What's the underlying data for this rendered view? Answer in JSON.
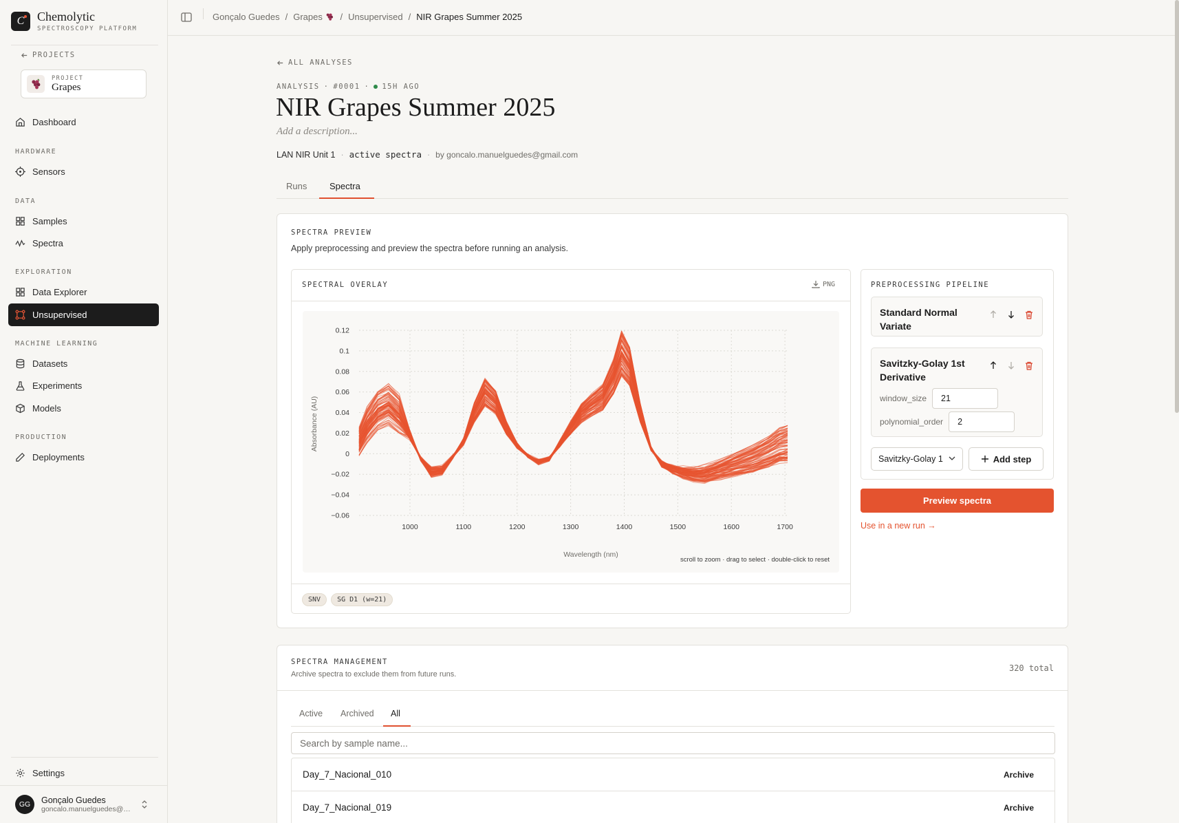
{
  "app": {
    "name": "Chemolytic",
    "subtitle": "SPECTROSCOPY PLATFORM"
  },
  "sidebar": {
    "back_label": "PROJECTS",
    "project": {
      "label": "PROJECT",
      "name": "Grapes"
    },
    "sections": {
      "hardware": "HARDWARE",
      "data": "DATA",
      "exploration": "EXPLORATION",
      "ml": "MACHINE LEARNING",
      "production": "PRODUCTION"
    },
    "items": {
      "dashboard": "Dashboard",
      "sensors": "Sensors",
      "samples": "Samples",
      "spectra": "Spectra",
      "data_explorer": "Data Explorer",
      "unsupervised": "Unsupervised",
      "datasets": "Datasets",
      "experiments": "Experiments",
      "models": "Models",
      "deployments": "Deployments",
      "settings": "Settings"
    },
    "user": {
      "initials": "GG",
      "name": "Gonçalo Guedes",
      "email": "goncalo.manuelguedes@gmail.com"
    }
  },
  "breadcrumb": {
    "c1": "Gonçalo Guedes",
    "c2": "Grapes",
    "c3": "Unsupervised",
    "c4": "NIR Grapes Summer 2025",
    "sep": "/"
  },
  "analysis": {
    "back": "ALL ANALYSES",
    "meta_kind": "ANALYSIS",
    "meta_id": "#0001",
    "meta_time": "15H AGO",
    "title": "NIR Grapes Summer 2025",
    "description_placeholder": "Add a description...",
    "device": "LAN NIR Unit 1",
    "source": "active spectra",
    "author": "by goncalo.manuelguedes@gmail.com",
    "dot": "·"
  },
  "tabs": {
    "runs": "Runs",
    "spectra": "Spectra"
  },
  "preview": {
    "label": "SPECTRA PREVIEW",
    "desc": "Apply preprocessing and preview the spectra before running an analysis.",
    "overlay_label": "SPECTRAL OVERLAY",
    "png": "PNG",
    "hint": "scroll to zoom · drag to select · double-click to reset",
    "chips": [
      "SNV",
      "SG D1 (w=21)"
    ]
  },
  "pipeline": {
    "label": "PREPROCESSING PIPELINE",
    "step1": "Standard Normal Variate",
    "step2": "Savitzky-Golay 1st Derivative",
    "param1_label": "window_size",
    "param1_value": "21",
    "param2_label": "polynomial_order",
    "param2_value": "2",
    "select_value": "Savitzky-Golay 1",
    "add_step": "Add step",
    "preview_button": "Preview spectra",
    "use_link": "Use in a new run →"
  },
  "management": {
    "label": "SPECTRA MANAGEMENT",
    "desc": "Archive spectra to exclude them from future runs.",
    "total": "320 total",
    "tabs": {
      "active": "Active",
      "archived": "Archived",
      "all": "All"
    },
    "search_placeholder": "Search by sample name...",
    "rows": [
      {
        "name": "Day_7_Nacional_010",
        "action": "Archive"
      },
      {
        "name": "Day_7_Nacional_019",
        "action": "Archive"
      }
    ]
  },
  "colors": {
    "accent": "#e4532f",
    "dark": "#1c1c1c"
  },
  "chart_data": {
    "type": "line",
    "xlabel": "Wavelength (nm)",
    "ylabel": "Absorbance (AU)",
    "xlim": [
      905,
      1705
    ],
    "ylim": [
      -0.06,
      0.12
    ],
    "x_ticks": [
      1000,
      1100,
      1200,
      1300,
      1400,
      1500,
      1600,
      1700
    ],
    "y_ticks": [
      0.12,
      0.1,
      0.08,
      0.06,
      0.04,
      0.02,
      0,
      -0.02,
      -0.04,
      -0.06
    ],
    "y_tick_labels": [
      "0.12",
      "0.1",
      "0.08",
      "0.06",
      "0.04",
      "0.02",
      "0",
      "−0.02",
      "−0.04",
      "−0.06"
    ],
    "x_tick_labels": [
      "1000",
      "1100",
      "1200",
      "1300",
      "1400",
      "1500",
      "1600",
      "1700"
    ],
    "grid": true,
    "series_count": 320,
    "mean_curve": {
      "x": [
        905,
        920,
        940,
        960,
        980,
        1000,
        1020,
        1040,
        1060,
        1080,
        1100,
        1120,
        1140,
        1160,
        1180,
        1200,
        1220,
        1240,
        1260,
        1280,
        1300,
        1320,
        1340,
        1360,
        1380,
        1395,
        1410,
        1430,
        1450,
        1470,
        1490,
        1510,
        1530,
        1550,
        1580,
        1610,
        1640,
        1670,
        1690,
        1705
      ],
      "y": [
        0.012,
        0.028,
        0.042,
        0.048,
        0.038,
        0.018,
        -0.005,
        -0.018,
        -0.016,
        -0.003,
        0.012,
        0.04,
        0.06,
        0.05,
        0.025,
        0.008,
        -0.002,
        -0.008,
        -0.005,
        0.01,
        0.025,
        0.04,
        0.048,
        0.055,
        0.075,
        0.098,
        0.085,
        0.04,
        0.005,
        -0.01,
        -0.015,
        -0.018,
        -0.02,
        -0.02,
        -0.015,
        -0.01,
        -0.005,
        0.002,
        0.008,
        0.01
      ]
    },
    "color": "#e8532f"
  }
}
